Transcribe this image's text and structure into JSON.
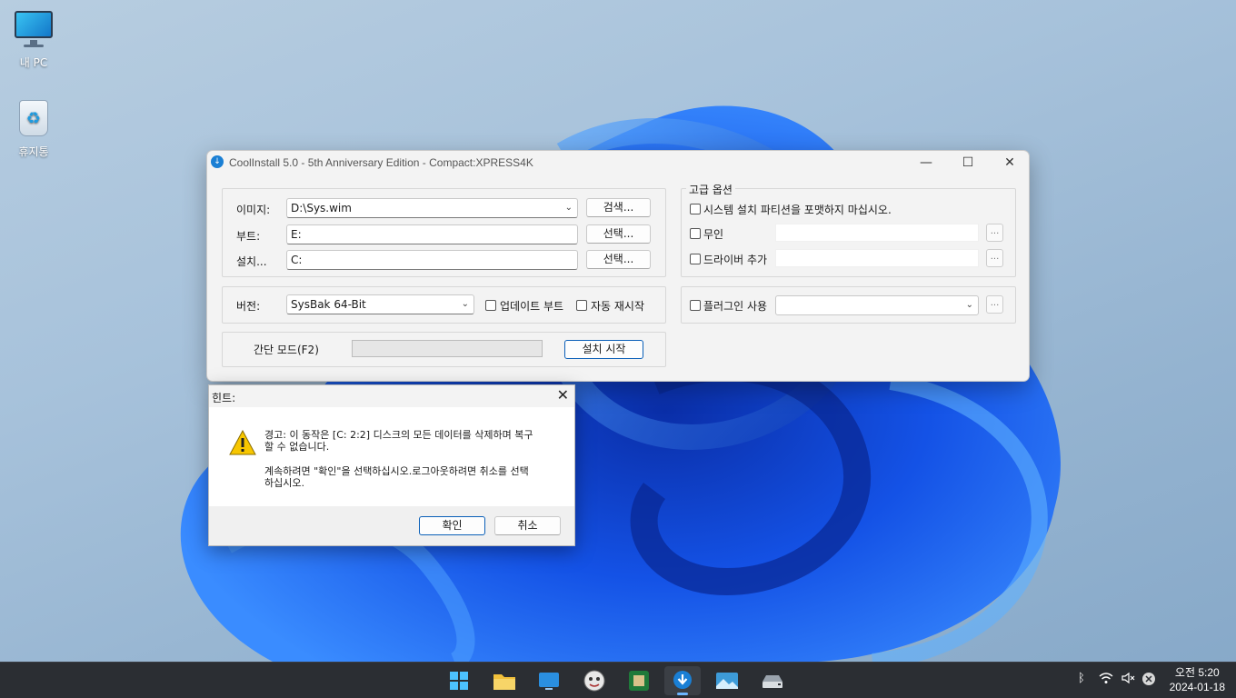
{
  "desktop": {
    "icons": [
      {
        "label": "내 PC",
        "icon": "this-pc-icon"
      },
      {
        "label": "휴지통",
        "icon": "recycle-bin-icon"
      }
    ]
  },
  "window": {
    "title": "CoolInstall 5.0 - 5th Anniversary Edition - Compact:XPRESS4K",
    "controls": {
      "minimize": "—",
      "maximize": "☐",
      "close": "✕"
    },
    "image_label": "이미지:",
    "image_value": "D:\\Sys.wim",
    "search_button": "검색...",
    "boot_label": "부트:",
    "boot_value": "E:",
    "boot_button": "선택...",
    "install_label": "설치...",
    "install_value": "C:",
    "install_button": "선택...",
    "version_label": "버전:",
    "version_value": "SysBak  64-Bit",
    "update_boot_label": "업데이트 부트",
    "auto_restart_label": "자동 재시작",
    "simple_mode_label": "간단 모드(F2)",
    "progress_value": 0,
    "start_button": "설치 시작",
    "advanced": {
      "title": "고급 옵션",
      "no_format_label": "시스템 설치 파티션을 포맷하지 마십시오.",
      "unattended_label": "무인",
      "add_driver_label": "드라이버 추가",
      "plugin_label": "플러그인 사용",
      "browse_label": "..."
    }
  },
  "dialog": {
    "title": "힌트:",
    "close": "✕",
    "line1": "경고: 이 동작은 [C: 2:2] 디스크의 모든 데이터를 삭제하며 복구",
    "line2": "할 수 없습니다.",
    "line3": "계속하려면 \"확인\"을 선택하십시오.로그아웃하려면 취소를 선택",
    "line4": "하십시오.",
    "ok_button": "확인",
    "cancel_button": "취소"
  },
  "taskbar": {
    "time": "오전 5:20",
    "date": "2024-01-18",
    "apps": [
      "start-icon",
      "file-explorer-icon",
      "remote-desktop-icon",
      "avatar-app-icon",
      "chip-app-icon",
      "coolinstall-icon",
      "image-viewer-icon",
      "drive-icon"
    ],
    "tray": [
      "bluetooth-icon",
      "wifi-icon",
      "volume-muted-icon",
      "notification-icon"
    ]
  },
  "colors": {
    "accent": "#0a5fb8",
    "taskbar": "#2b2e33",
    "wallpaper_bloom": "#1558e0"
  }
}
